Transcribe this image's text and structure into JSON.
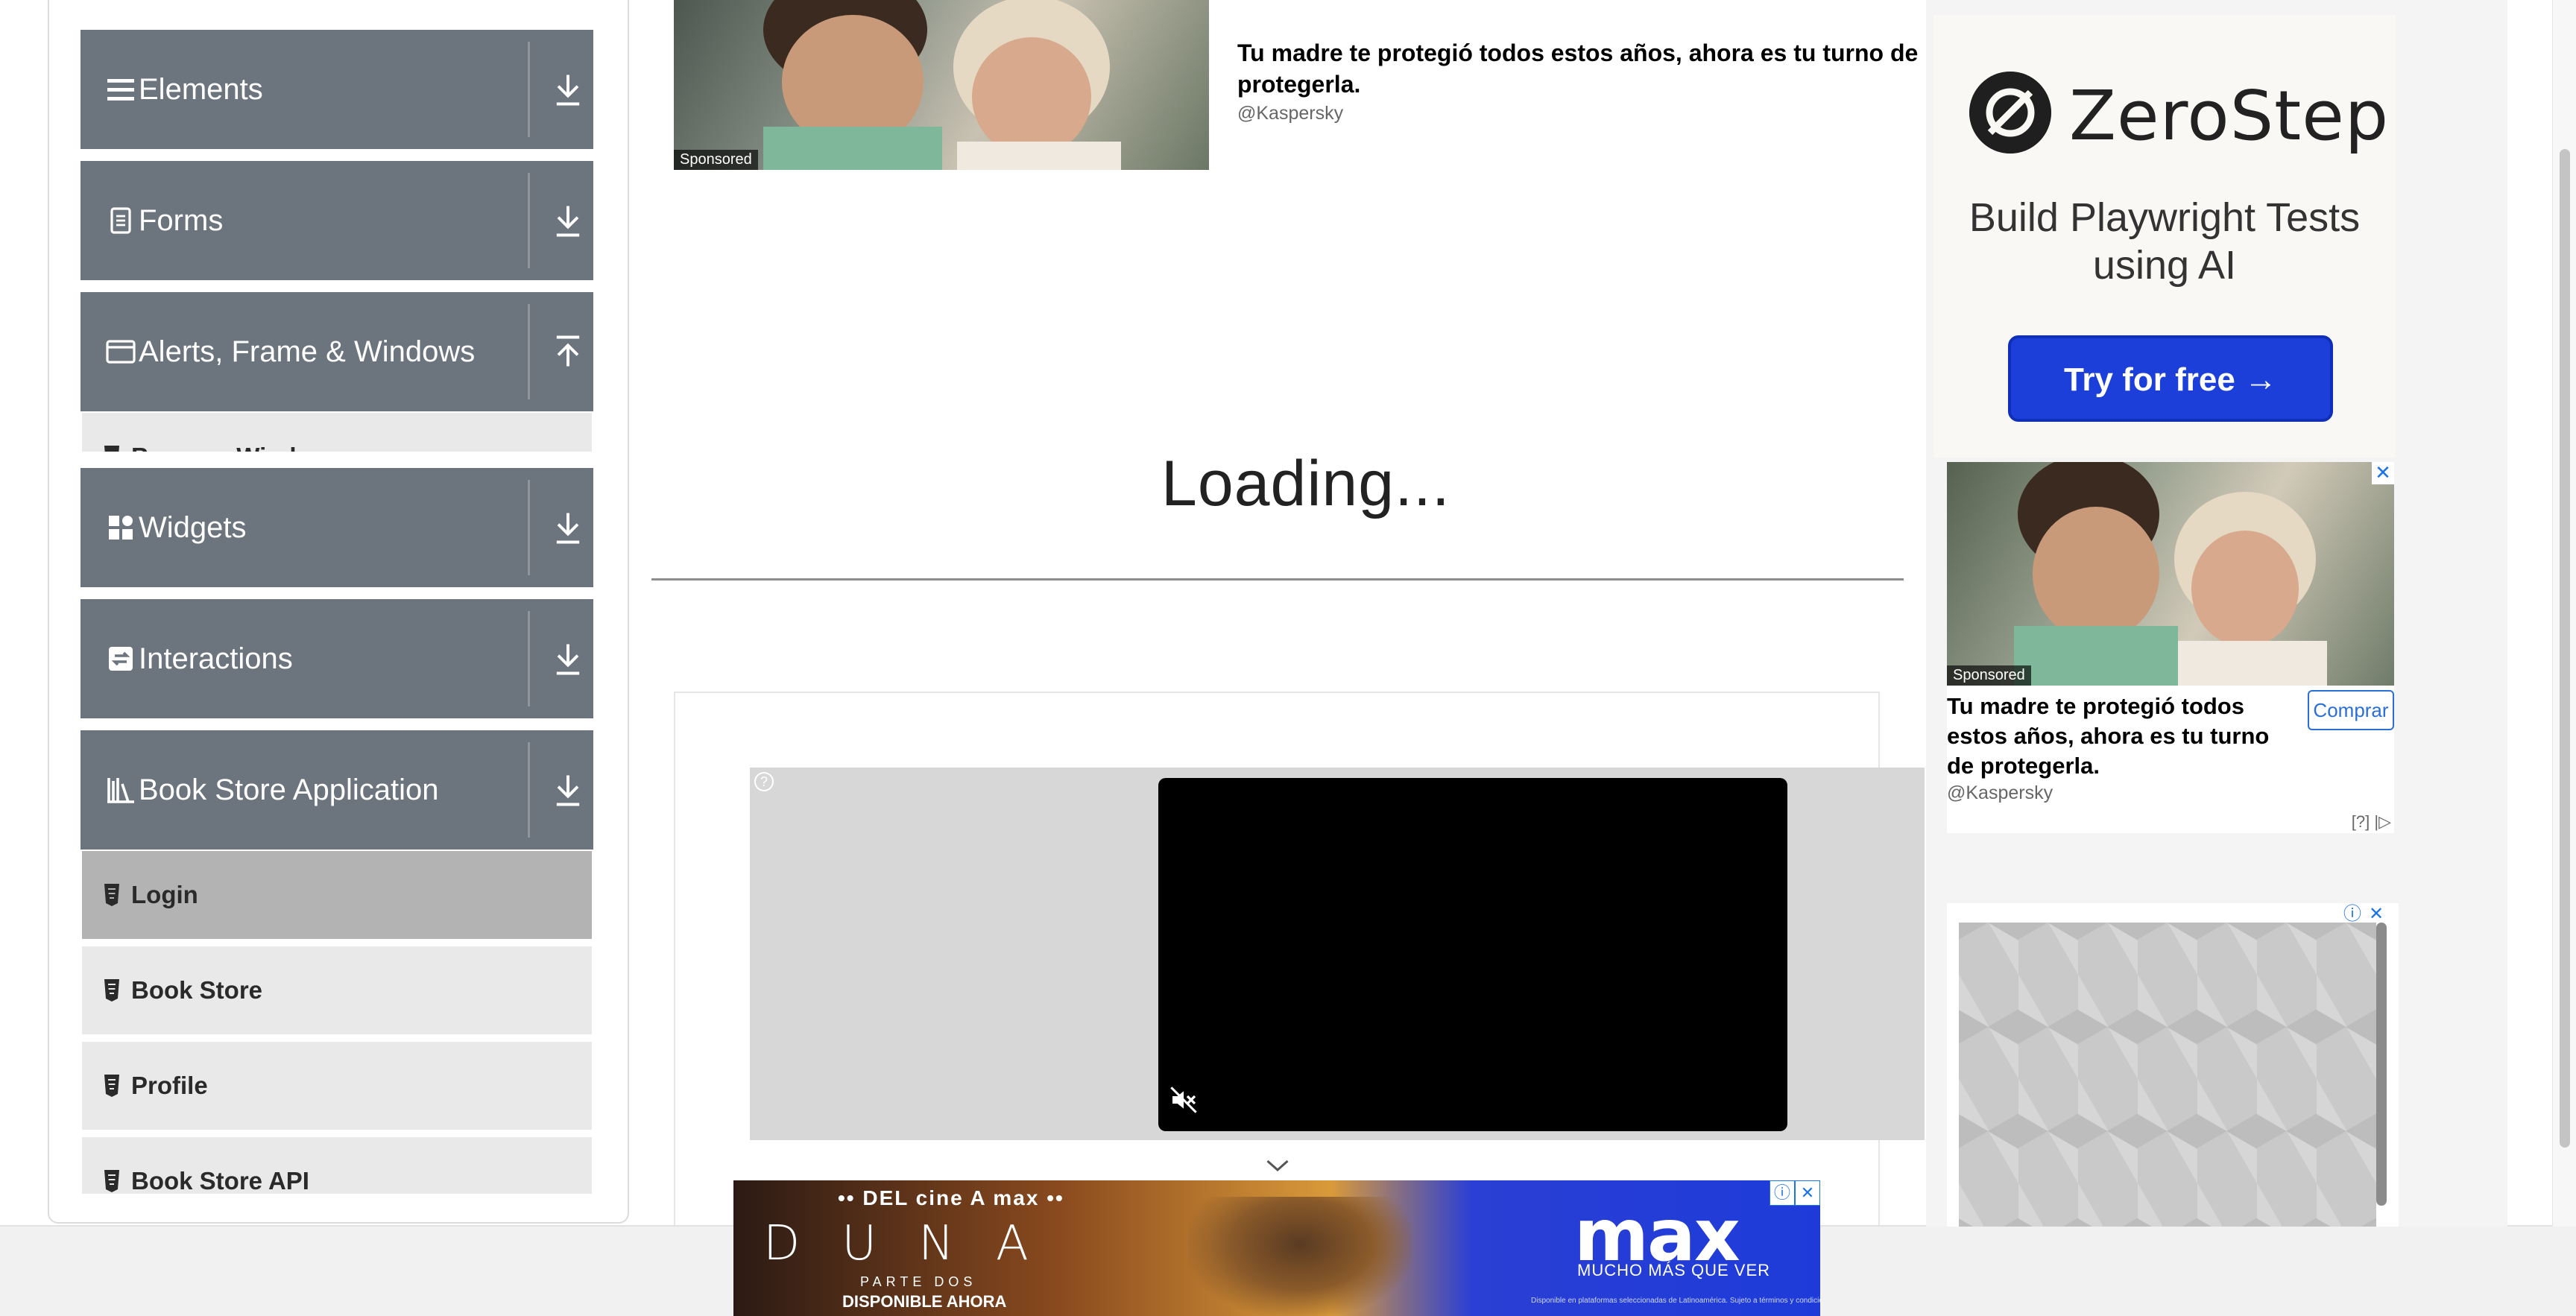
{
  "sidebar": {
    "groups": [
      {
        "label": "Elements",
        "icon": "hamburger-icon",
        "arrow": "down"
      },
      {
        "label": "Forms",
        "icon": "form-icon",
        "arrow": "down"
      },
      {
        "label": "Alerts, Frame & Windows",
        "icon": "window-icon",
        "arrow": "up"
      },
      {
        "label": "Widgets",
        "icon": "widgets-icon",
        "arrow": "down"
      },
      {
        "label": "Interactions",
        "icon": "interactions-icon",
        "arrow": "down"
      },
      {
        "label": "Book Store Application",
        "icon": "books-icon",
        "arrow": "down"
      }
    ],
    "clipped_item": "Browser Windows",
    "book_items": [
      {
        "label": "Login",
        "active": true
      },
      {
        "label": "Book Store",
        "active": false
      },
      {
        "label": "Profile",
        "active": false
      },
      {
        "label": "Book Store API",
        "active": false
      }
    ]
  },
  "main": {
    "top_ad": {
      "title": "Tu madre te protegió todos estos años, ahora es tu turno de protegerla.",
      "by": "@Kaspersky",
      "sponsored": "Sponsored"
    },
    "loading": "Loading...",
    "player": {
      "help": "?"
    }
  },
  "right_ads": {
    "zerostep": {
      "name": "ZeroStep",
      "tagline": "Build Playwright Tests using AI",
      "cta": "Try for free →"
    },
    "kaspersky": {
      "sponsored": "Sponsored",
      "title": "Tu madre te protegió todos estos años, ahora es tu turno de protegerla.",
      "buy": "Comprar",
      "by": "@Kaspersky",
      "footer": "[?] |▷"
    }
  },
  "bottom_ad": {
    "top_text": "•• DEL cine A max ••",
    "title": "DUNA",
    "subtitle": "PARTE DOS",
    "availability": "DISPONIBLE AHORA",
    "brand": "max",
    "slogan": "MUCHO MÁS QUE VER",
    "fine_print": "Disponible en plataformas seleccionadas de Latinoamérica. Sujeto a términos y condiciones."
  },
  "colors": {
    "accordion": "#6c757d",
    "active_item": "#b3b3b3",
    "item": "#e9e9e9",
    "cta_blue": "#1b3fd8"
  }
}
